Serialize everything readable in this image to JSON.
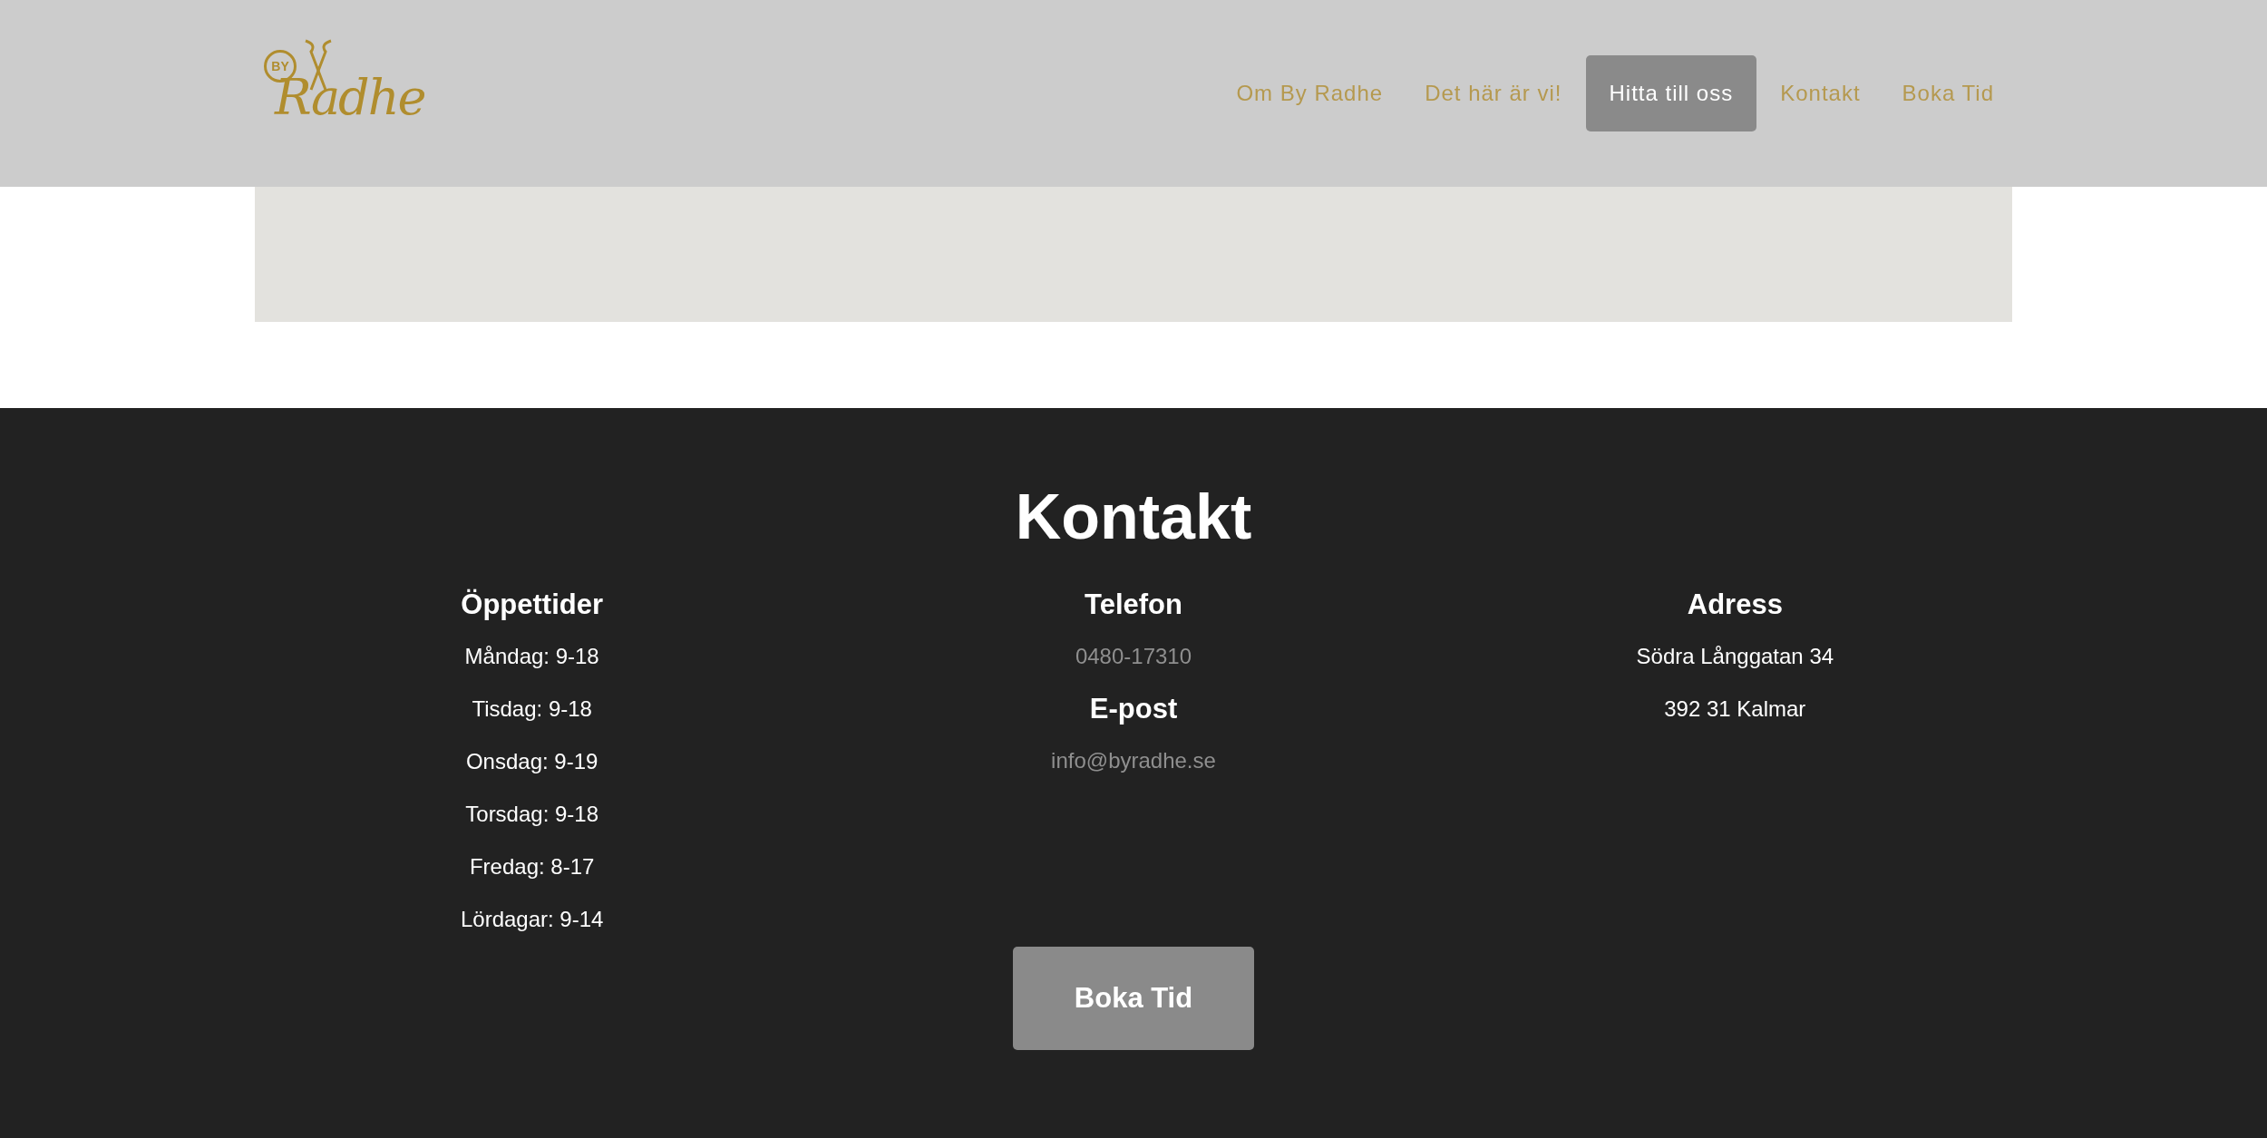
{
  "header": {
    "logo": {
      "badge": "BY",
      "wordmark": "Radhe"
    },
    "nav": [
      {
        "label": "Om By Radhe",
        "selected": false
      },
      {
        "label": "Det här är vi!",
        "selected": false
      },
      {
        "label": "Hitta till oss",
        "selected": true
      },
      {
        "label": "Kontakt",
        "selected": false
      },
      {
        "label": "Boka Tid",
        "selected": false
      }
    ]
  },
  "contact": {
    "title": "Kontakt",
    "columns": [
      {
        "sections": [
          {
            "heading": "Öppettider",
            "lines": [
              {
                "kind": "text",
                "text": "Måndag: 9-18"
              },
              {
                "kind": "text",
                "text": "Tisdag: 9-18"
              },
              {
                "kind": "text",
                "text": "Onsdag: 9-19"
              },
              {
                "kind": "text",
                "text": "Torsdag: 9-18"
              },
              {
                "kind": "text",
                "text": "Fredag: 8-17"
              },
              {
                "kind": "text",
                "text": "Lördagar: 9-14"
              }
            ]
          }
        ]
      },
      {
        "sections": [
          {
            "heading": "Telefon",
            "lines": [
              {
                "kind": "link",
                "text": "0480-17310"
              }
            ]
          },
          {
            "heading": "E-post",
            "lines": [
              {
                "kind": "link",
                "text": "info@byradhe.se"
              }
            ]
          }
        ]
      },
      {
        "sections": [
          {
            "heading": "Adress",
            "lines": [
              {
                "kind": "text",
                "text": "Södra Långgatan 34"
              },
              {
                "kind": "text",
                "text": "392 31 Kalmar"
              }
            ]
          }
        ]
      }
    ],
    "button": "Boka Tid"
  }
}
